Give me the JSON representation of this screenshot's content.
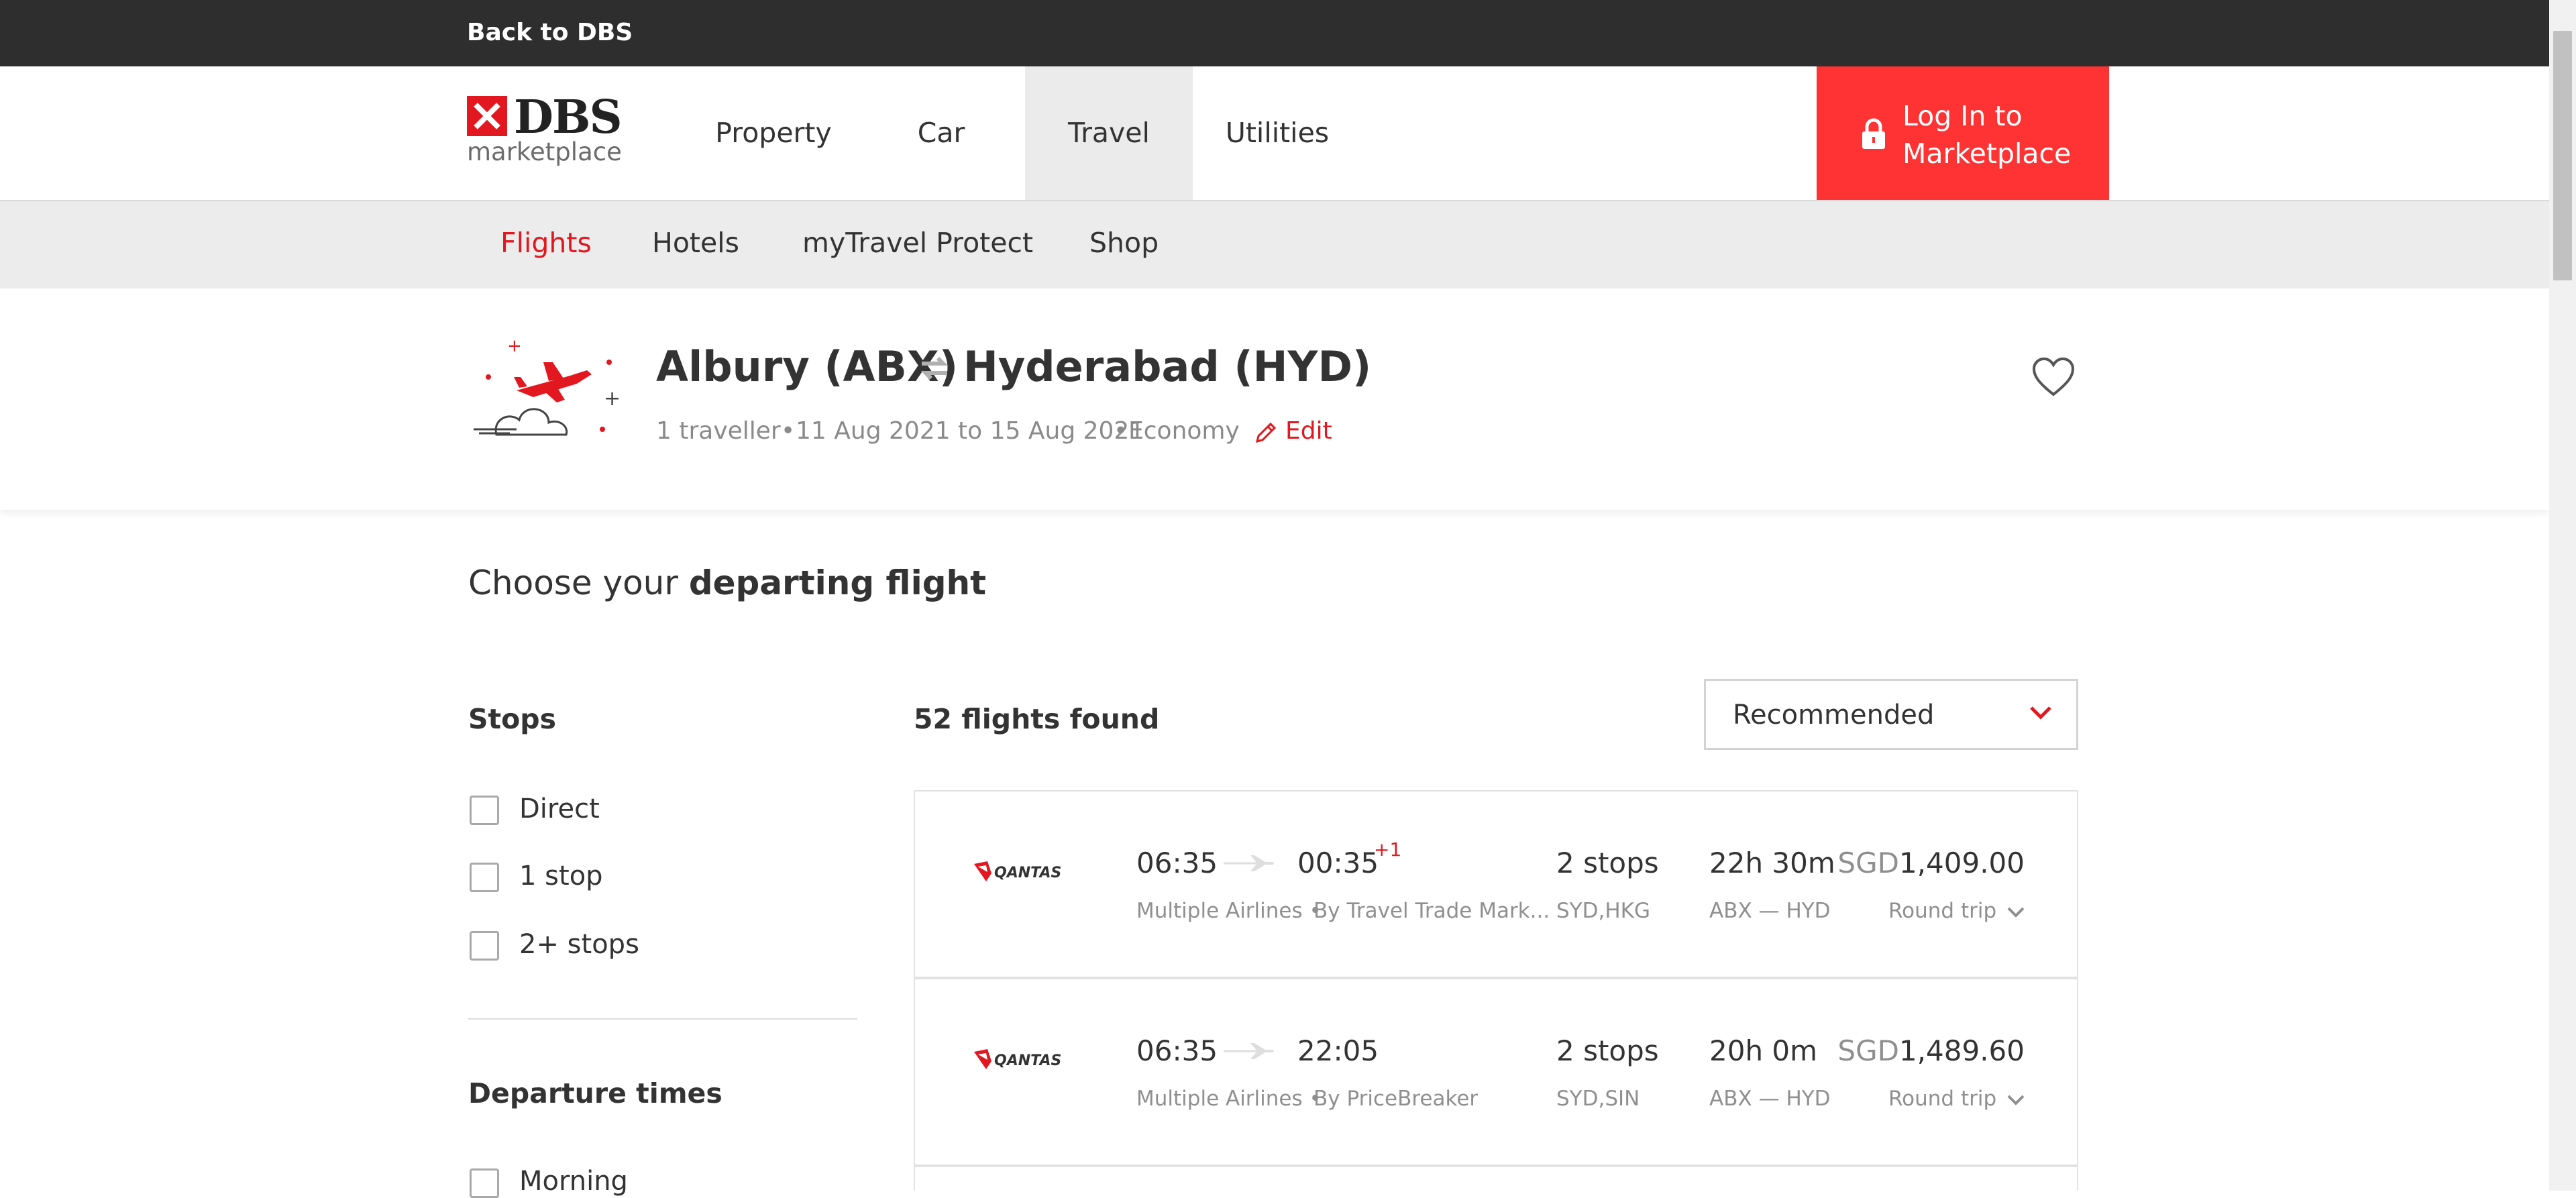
{
  "topbar": {
    "back_label": "Back to DBS"
  },
  "logo": {
    "brand": "DBS",
    "sub": "marketplace"
  },
  "nav": {
    "items": [
      {
        "label": "Property"
      },
      {
        "label": "Car"
      },
      {
        "label": "Travel",
        "active": true
      },
      {
        "label": "Utilities"
      }
    ],
    "login_line1": "Log In to",
    "login_line2": "Marketplace"
  },
  "subnav": {
    "items": [
      {
        "label": "Flights",
        "active": true
      },
      {
        "label": "Hotels"
      },
      {
        "label": "myTravel Protect"
      },
      {
        "label": "Shop"
      }
    ]
  },
  "search": {
    "origin": "Albury (ABX)",
    "destination": "Hyderabad (HYD)",
    "travellers": "1 traveller",
    "dates": "11 Aug 2021 to 15 Aug 2021",
    "cabin": "Economy",
    "edit_label": "Edit"
  },
  "main": {
    "choose_prefix": "Choose your",
    "choose_bold": "departing flight",
    "found": "52 flights found",
    "sort": {
      "selected": "Recommended"
    }
  },
  "filters": {
    "stops_title": "Stops",
    "stops": [
      {
        "label": "Direct",
        "checked": false
      },
      {
        "label": "1 stop",
        "checked": false
      },
      {
        "label": "2+ stops",
        "checked": false
      }
    ],
    "departure_title": "Departure times",
    "departure": [
      {
        "label": "Morning",
        "checked": false
      }
    ]
  },
  "flights": [
    {
      "airline_logo": "QANTAS",
      "depart": "06:35",
      "arrive": "00:35",
      "day_offset": "+1",
      "airlines": "Multiple Airlines •",
      "agent": "By Travel Trade Mark...",
      "stops": "2 stops",
      "via": "SYD,HKG",
      "duration": "22h 30m",
      "from": "ABX",
      "to": "HYD",
      "currency": "SGD",
      "price": "1,409.00",
      "trip_type": "Round trip"
    },
    {
      "airline_logo": "QANTAS",
      "depart": "06:35",
      "arrive": "22:05",
      "day_offset": "",
      "airlines": "Multiple Airlines •",
      "agent": "By PriceBreaker",
      "stops": "2 stops",
      "via": "SYD,SIN",
      "duration": "20h 0m",
      "from": "ABX",
      "to": "HYD",
      "currency": "SGD",
      "price": "1,489.60",
      "trip_type": "Round trip"
    }
  ],
  "colors": {
    "accent": "#e3171f",
    "login_bg": "#ff3333",
    "topbar": "#2e2e2e"
  },
  "icons": [
    "lock-icon",
    "swap-arrows-icon",
    "pencil-icon",
    "heart-icon",
    "chevron-down-icon",
    "plane-icon",
    "flight-illustration-icon"
  ]
}
